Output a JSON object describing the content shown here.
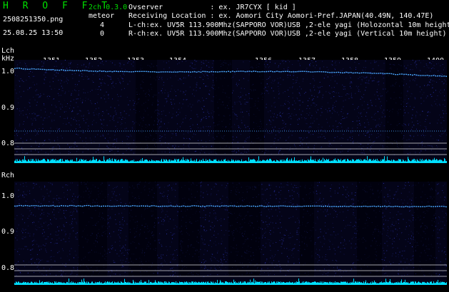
{
  "header": {
    "logo": "H R O F F T",
    "filename": "2508251350.png",
    "datetime": "25.08.25 13:50",
    "mode": "2ch 0.3.0",
    "meteor_label": "meteor",
    "lch_count": "4",
    "rch_count": "0",
    "observer_line": "Ovserver           : ex. JR7CYX [ kid ]",
    "location_line": "Receiving Location : ex. Aomori City Aomori-Pref.JAPAN(40.49N, 140.47E)",
    "lch_line": "L-ch:ex. UV5R 113.900Mhz(SAPPORO VOR)USB ,2-ele yagi (Holozontal 10m height)",
    "rch_line": "R-ch:ex. UV5R 113.900Mhz(SAPPORO VOR)USB ,2-ele yagi (Vertical 10m height)"
  },
  "lch": {
    "label": "Lch",
    "unit": "kHz",
    "y_ticks": [
      "1.0",
      "0.9",
      "0.8"
    ],
    "time_ticks": [
      "1351",
      "1352",
      "1353",
      "1354",
      "1356",
      "1357",
      "1358",
      "1359",
      "1400"
    ]
  },
  "rch": {
    "label": "Rch",
    "y_ticks": [
      "1.0",
      "0.9",
      "0.8"
    ]
  },
  "colors": {
    "background": "#000000",
    "header_green": "#00e000",
    "spectrogram_bg": "#040418",
    "signal_trace": "#4aa8ff",
    "level_bars": "#00e0ff",
    "grid_lines": "#ffffff"
  }
}
